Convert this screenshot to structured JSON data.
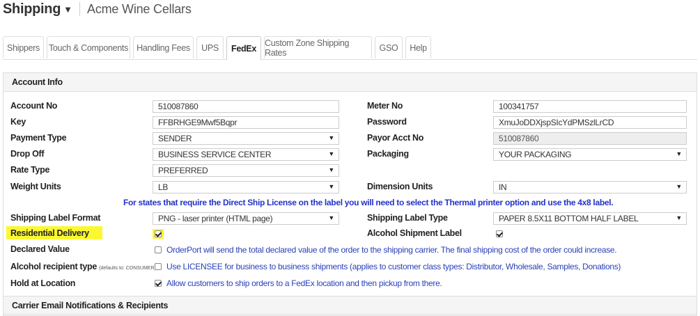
{
  "header": {
    "app_title": "Shipping",
    "company": "Acme Wine Cellars"
  },
  "tabs": [
    {
      "label": "Shippers"
    },
    {
      "label": "Touch & Components"
    },
    {
      "label": "Handling Fees"
    },
    {
      "label": "UPS"
    },
    {
      "label": "FedEx",
      "active": true
    },
    {
      "label": "Custom Zone Shipping Rates"
    },
    {
      "label": "GSO"
    },
    {
      "label": "Help"
    }
  ],
  "account_info": {
    "heading": "Account Info",
    "account_no": {
      "label": "Account No",
      "value": "510087860"
    },
    "meter_no": {
      "label": "Meter No",
      "value": "100341757"
    },
    "key": {
      "label": "Key",
      "value": "FFBRHGE9Mwf5Bqpr"
    },
    "password": {
      "label": "Password",
      "value": "XmuJoDDXjspSIcYdPMSzlLrCD"
    },
    "payment_type": {
      "label": "Payment Type",
      "value": "SENDER"
    },
    "payor_acct_no": {
      "label": "Payor Acct No",
      "value": "510087860"
    },
    "drop_off": {
      "label": "Drop Off",
      "value": "BUSINESS SERVICE CENTER"
    },
    "packaging": {
      "label": "Packaging",
      "value": "YOUR PACKAGING"
    },
    "rate_type": {
      "label": "Rate Type",
      "value": "PREFERRED"
    },
    "weight_units": {
      "label": "Weight Units",
      "value": "LB"
    },
    "dimension_units": {
      "label": "Dimension Units",
      "value": "IN"
    },
    "notice": "For states that require the Direct Ship License on the label you will need to select the Thermal printer option and use the 4x8 label.",
    "label_format": {
      "label": "Shipping Label Format",
      "value": "PNG - laser printer (HTML page)"
    },
    "label_type": {
      "label": "Shipping Label Type",
      "value": "PAPER 8.5X11 BOTTOM HALF LABEL"
    },
    "residential_delivery": {
      "label": "Residential Delivery",
      "checked": true
    },
    "alcohol_shipment_label": {
      "label": "Alcohol Shipment Label",
      "checked": true
    },
    "declared_value": {
      "label": "Declared Value",
      "checked": false,
      "description": "OrderPort will send the total declared value of the order to the shipping carrier. The final shipping cost of the order could increase."
    },
    "alcohol_recipient_type": {
      "label": "Alcohol recipient type",
      "note": "(defaults to: CONSUMER)",
      "checked": false,
      "description": "Use LICENSEE for business to business shipments (applies to customer class types: Distributor, Wholesale, Samples, Donations)"
    },
    "hold_at_location": {
      "label": "Hold at Location",
      "checked": true,
      "description": "Allow customers to ship orders to a FedEx location and then pickup from there."
    }
  },
  "carrier_email": {
    "heading": "Carrier Email Notifications & Recipients"
  },
  "colors": {
    "highlight": "#fbf832",
    "link_blue": "#2a3fb8",
    "notice_blue": "#2232c8"
  }
}
